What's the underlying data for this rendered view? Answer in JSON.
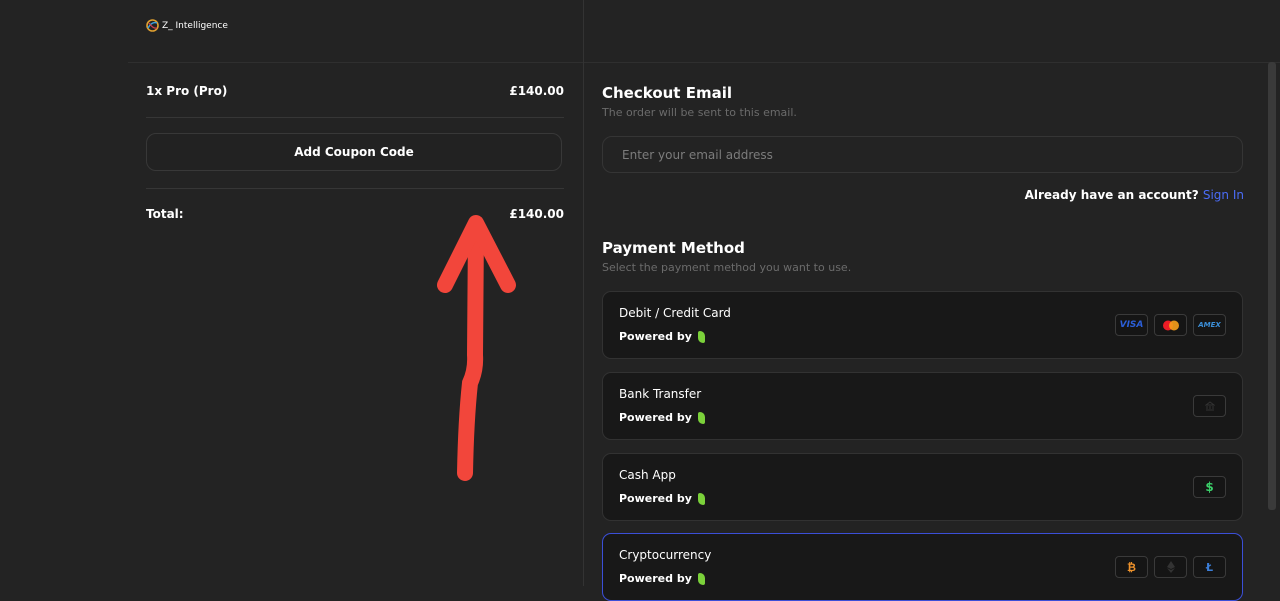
{
  "brand": {
    "name": "Z_ Intelligence"
  },
  "cart": {
    "item_label": "1x  Pro (Pro)",
    "item_price": "£140.00",
    "coupon_label": "Add Coupon Code",
    "total_label": "Total:",
    "total_value": "£140.00"
  },
  "checkout": {
    "email_title": "Checkout Email",
    "email_sub": "The order will be sent to this email.",
    "email_placeholder": "Enter your email address",
    "account_prompt": "Already have an account?",
    "sign_in": "Sign In"
  },
  "payment": {
    "title": "Payment Method",
    "sub": "Select the payment method you want to use.",
    "powered_by": "Powered by",
    "methods": [
      {
        "name": "Debit / Credit Card",
        "badges": [
          "VISA",
          "mastercard",
          "AMEX"
        ]
      },
      {
        "name": "Bank Transfer",
        "badges": [
          "bank"
        ]
      },
      {
        "name": "Cash App",
        "badges": [
          "$"
        ]
      },
      {
        "name": "Cryptocurrency",
        "badges": [
          "₿",
          "ethereum",
          "Ł"
        ],
        "selected": true
      }
    ]
  },
  "colors": {
    "accent": "#4a6cf7",
    "arrow": "#f2463b",
    "leaf": "#7bd13a"
  }
}
